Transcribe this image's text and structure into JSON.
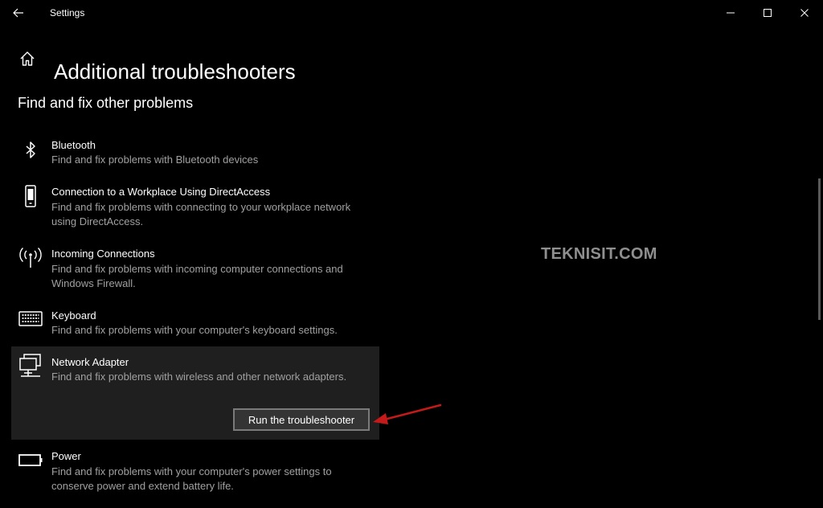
{
  "window": {
    "title": "Settings",
    "controls": [
      "minimize",
      "maximize",
      "close"
    ]
  },
  "page": {
    "title": "Additional troubleshooters",
    "section_title": "Find and fix other problems"
  },
  "troubleshooters": [
    {
      "icon": "bluetooth-icon",
      "name": "Bluetooth",
      "description": "Find and fix problems with Bluetooth devices"
    },
    {
      "icon": "phone-device-icon",
      "name": "Connection to a Workplace Using DirectAccess",
      "description": "Find and fix problems with connecting to your workplace network using DirectAccess."
    },
    {
      "icon": "antenna-icon",
      "name": "Incoming Connections",
      "description": "Find and fix problems with incoming computer connections and Windows Firewall."
    },
    {
      "icon": "keyboard-icon",
      "name": "Keyboard",
      "description": "Find and fix problems with your computer's keyboard settings."
    },
    {
      "icon": "network-adapter-icon",
      "name": "Network Adapter",
      "description": "Find and fix problems with wireless and other network adapters.",
      "selected": true,
      "action_label": "Run the troubleshooter"
    },
    {
      "icon": "battery-icon",
      "name": "Power",
      "description": "Find and fix problems with your computer's power settings to conserve power and extend battery life."
    }
  ],
  "watermark": "TEKNISIT.COM",
  "colors": {
    "background": "#000000",
    "text_primary": "#ffffff",
    "text_secondary": "#a0a0a0",
    "selected_background": "#1f1f1f",
    "annotation_arrow": "#c41a1a"
  }
}
